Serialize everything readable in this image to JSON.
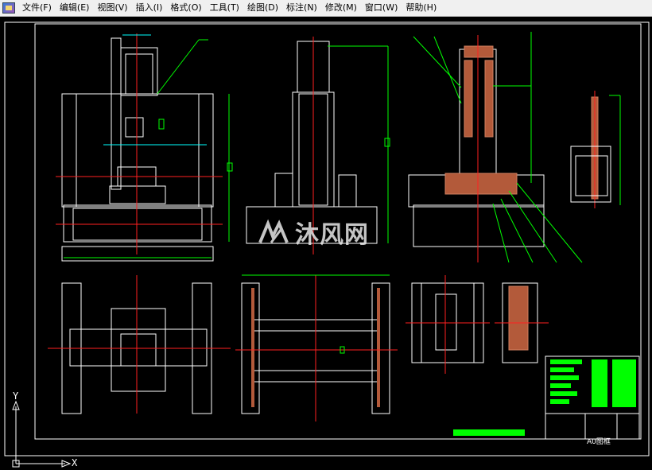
{
  "menu": {
    "items": [
      {
        "label": "文件(F)"
      },
      {
        "label": "编辑(E)"
      },
      {
        "label": "视图(V)"
      },
      {
        "label": "插入(I)"
      },
      {
        "label": "格式(O)"
      },
      {
        "label": "工具(T)"
      },
      {
        "label": "绘图(D)"
      },
      {
        "label": "标注(N)"
      },
      {
        "label": "修改(M)"
      },
      {
        "label": "窗口(W)"
      },
      {
        "label": "帮助(H)"
      }
    ]
  },
  "drawing": {
    "title_block_text": "A0图框",
    "ucs_y": "Y",
    "ucs_x": "X"
  },
  "watermark": {
    "text": "沐风网"
  },
  "colors": {
    "background": "#000000",
    "line_white": "#ffffff",
    "line_red": "#ff2020",
    "line_green": "#00ff00",
    "line_cyan": "#00ffff"
  }
}
